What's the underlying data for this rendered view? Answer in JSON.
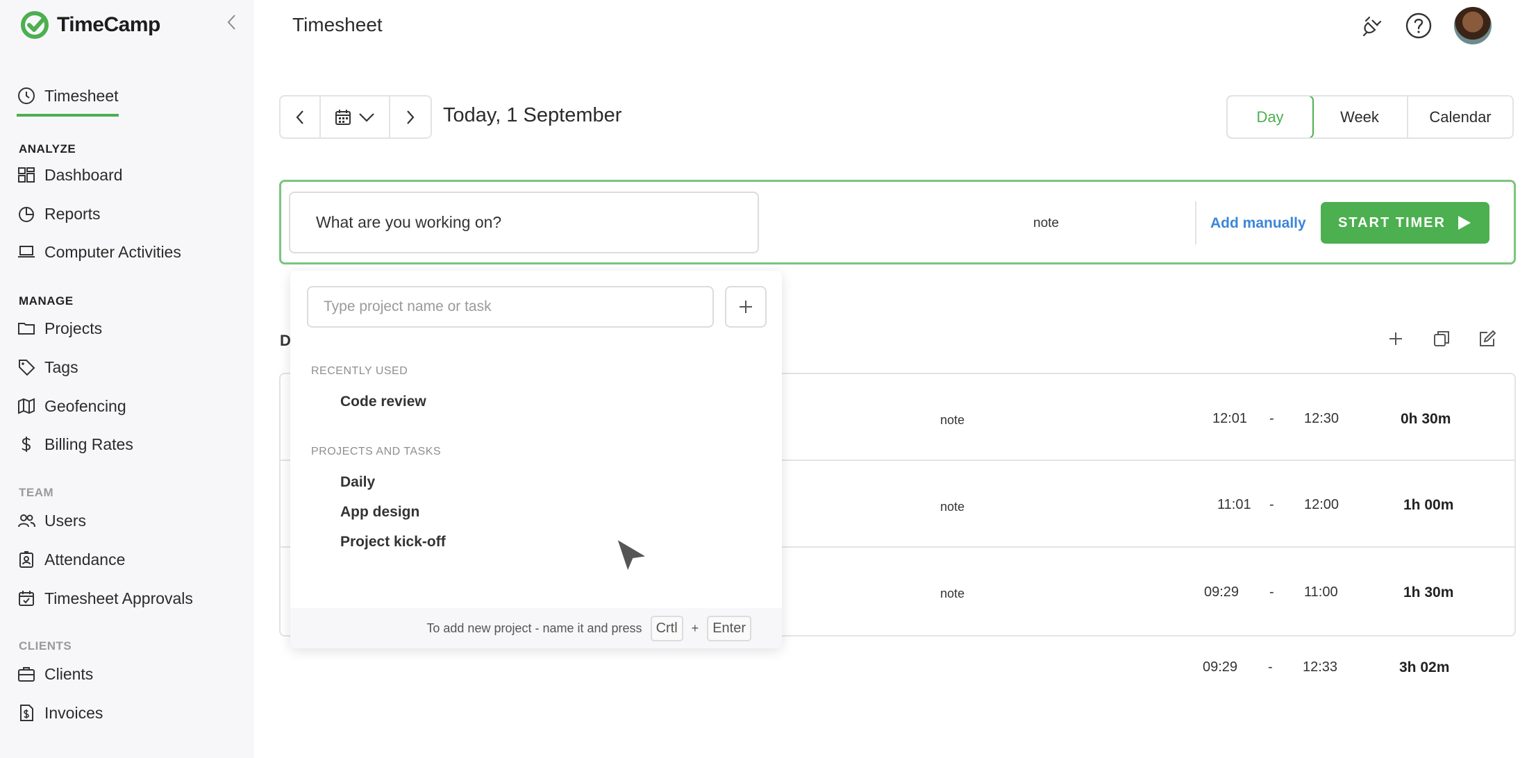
{
  "brand": {
    "name": "TimeCamp",
    "accent": "#4caf50"
  },
  "sidebar": {
    "active_item": "Timesheet",
    "sections": {
      "analyze": "ANALYZE",
      "manage": "MANAGE",
      "team": "TEAM",
      "clients": "CLIENTS"
    },
    "items": {
      "timesheet": "Timesheet",
      "dashboard": "Dashboard",
      "reports": "Reports",
      "computer_activities": "Computer Activities",
      "projects": "Projects",
      "tags": "Tags",
      "geofencing": "Geofencing",
      "billing_rates": "Billing Rates",
      "users": "Users",
      "attendance": "Attendance",
      "timesheet_approvals": "Timesheet Approvals",
      "clients": "Clients",
      "invoices": "Invoices"
    }
  },
  "header": {
    "title": "Timesheet"
  },
  "date_nav": {
    "label": "Today, 1 September"
  },
  "views": {
    "day": "Day",
    "week": "Week",
    "calendar": "Calendar",
    "active": "Day"
  },
  "timer": {
    "task_placeholder": "What are you working on?",
    "note": "note",
    "add_manually": "Add manually",
    "start_label": "START TIMER"
  },
  "day_header": "D",
  "entries": [
    {
      "note": "note",
      "start": "12:01",
      "end": "12:30",
      "duration": "0h 30m"
    },
    {
      "note": "note",
      "start": "11:01",
      "end": "12:00",
      "duration": "1h 00m"
    },
    {
      "note": "note",
      "start": "09:29",
      "end": "11:00",
      "duration": "1h 30m"
    }
  ],
  "total": {
    "start": "09:29",
    "end": "12:33",
    "duration": "3h 02m",
    "dash": "-"
  },
  "dropdown": {
    "search_placeholder": "Type project name or task",
    "recently_used_label": "RECENTLY USED",
    "recently_used": [
      "Code review"
    ],
    "projects_label": "PROJECTS AND TASKS",
    "projects": [
      "Daily",
      "App design",
      "Project kick-off"
    ],
    "footer_text": "To add new project - name it and press",
    "key_ctrl": "Crtl",
    "key_plus": "+",
    "key_enter": "Enter"
  }
}
